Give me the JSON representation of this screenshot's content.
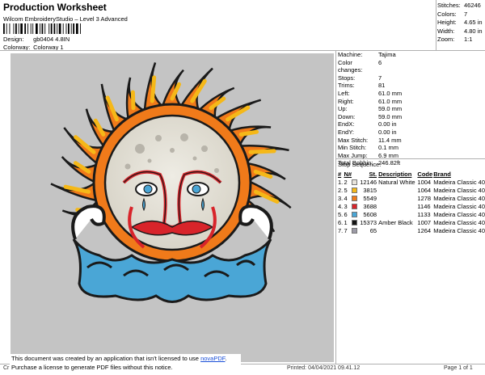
{
  "header": {
    "title": "Production Worksheet",
    "subtitle": "Wilcom EmbroideryStudio – Level 3 Advanced",
    "design_label": "Design:",
    "design_value": "gb0404 4.8IN",
    "colorway_label": "Colorway:",
    "colorway_value": "Colorway 1"
  },
  "summary": [
    {
      "label": "Stitches:",
      "value": "46246"
    },
    {
      "label": "Colors:",
      "value": "7"
    },
    {
      "label": "Height:",
      "value": "4.65 in"
    },
    {
      "label": "Width:",
      "value": "4.80 in"
    },
    {
      "label": "Zoom:",
      "value": "1:1"
    }
  ],
  "machine_info": [
    {
      "label": "Machine:",
      "value": "Tajima"
    },
    {
      "label": "Color changes:",
      "value": "6"
    },
    {
      "label": "Stops:",
      "value": "7"
    },
    {
      "label": "Trims:",
      "value": "81"
    },
    {
      "label": "Left:",
      "value": "61.0 mm"
    },
    {
      "label": "Right:",
      "value": "61.0 mm"
    },
    {
      "label": "Up:",
      "value": "59.0 mm"
    },
    {
      "label": "Down:",
      "value": "59.0 mm"
    },
    {
      "label": "EndX:",
      "value": "0.00 in"
    },
    {
      "label": "EndY:",
      "value": "0.00 in"
    },
    {
      "label": "Max Stitch:",
      "value": "11.4 mm"
    },
    {
      "label": "Min Stitch:",
      "value": "0.1 mm"
    },
    {
      "label": "Max Jump:",
      "value": "6.9 mm"
    },
    {
      "label": "Total Bobbin:",
      "value": "246.82ft"
    }
  ],
  "stop_sequence": {
    "title": "Stop Sequence:",
    "headers": [
      "#",
      "N#",
      "St.",
      "Description",
      "Code",
      "Brand"
    ],
    "rows": [
      {
        "num": "1.",
        "n": "2",
        "color": "#e8e4dc",
        "st": "12146",
        "desc": "Natural White",
        "code": "1004",
        "brand": "Madeira Classic 40"
      },
      {
        "num": "2.",
        "n": "5",
        "color": "#f5b818",
        "st": "3815",
        "desc": "",
        "code": "1064",
        "brand": "Madeira Classic 40"
      },
      {
        "num": "3.",
        "n": "4",
        "color": "#f07a1a",
        "st": "5549",
        "desc": "",
        "code": "1278",
        "brand": "Madeira Classic 40"
      },
      {
        "num": "4.",
        "n": "3",
        "color": "#d8242a",
        "st": "3688",
        "desc": "",
        "code": "1146",
        "brand": "Madeira Classic 40"
      },
      {
        "num": "5.",
        "n": "6",
        "color": "#4aa6d6",
        "st": "5608",
        "desc": "",
        "code": "1133",
        "brand": "Madeira Classic 40"
      },
      {
        "num": "6.",
        "n": "1",
        "color": "#141414",
        "st": "15373",
        "desc": "Amber Black",
        "code": "1007",
        "brand": "Madeira Classic 40"
      },
      {
        "num": "7.",
        "n": "7",
        "color": "#9c9aa6",
        "st": "65",
        "desc": "",
        "code": "1264",
        "brand": "Madeira Classic 40"
      }
    ]
  },
  "notice": {
    "line1": "This document was created by an application that isn't licensed to use ",
    "link": "novaPDF",
    "line1_end": ".",
    "line2": "Purchase a license to generate PDF files without this notice."
  },
  "footer": {
    "left": "Cr",
    "printed": "Printed: 04/04/2021 09.41.12",
    "page": "Page 1 of 1"
  }
}
